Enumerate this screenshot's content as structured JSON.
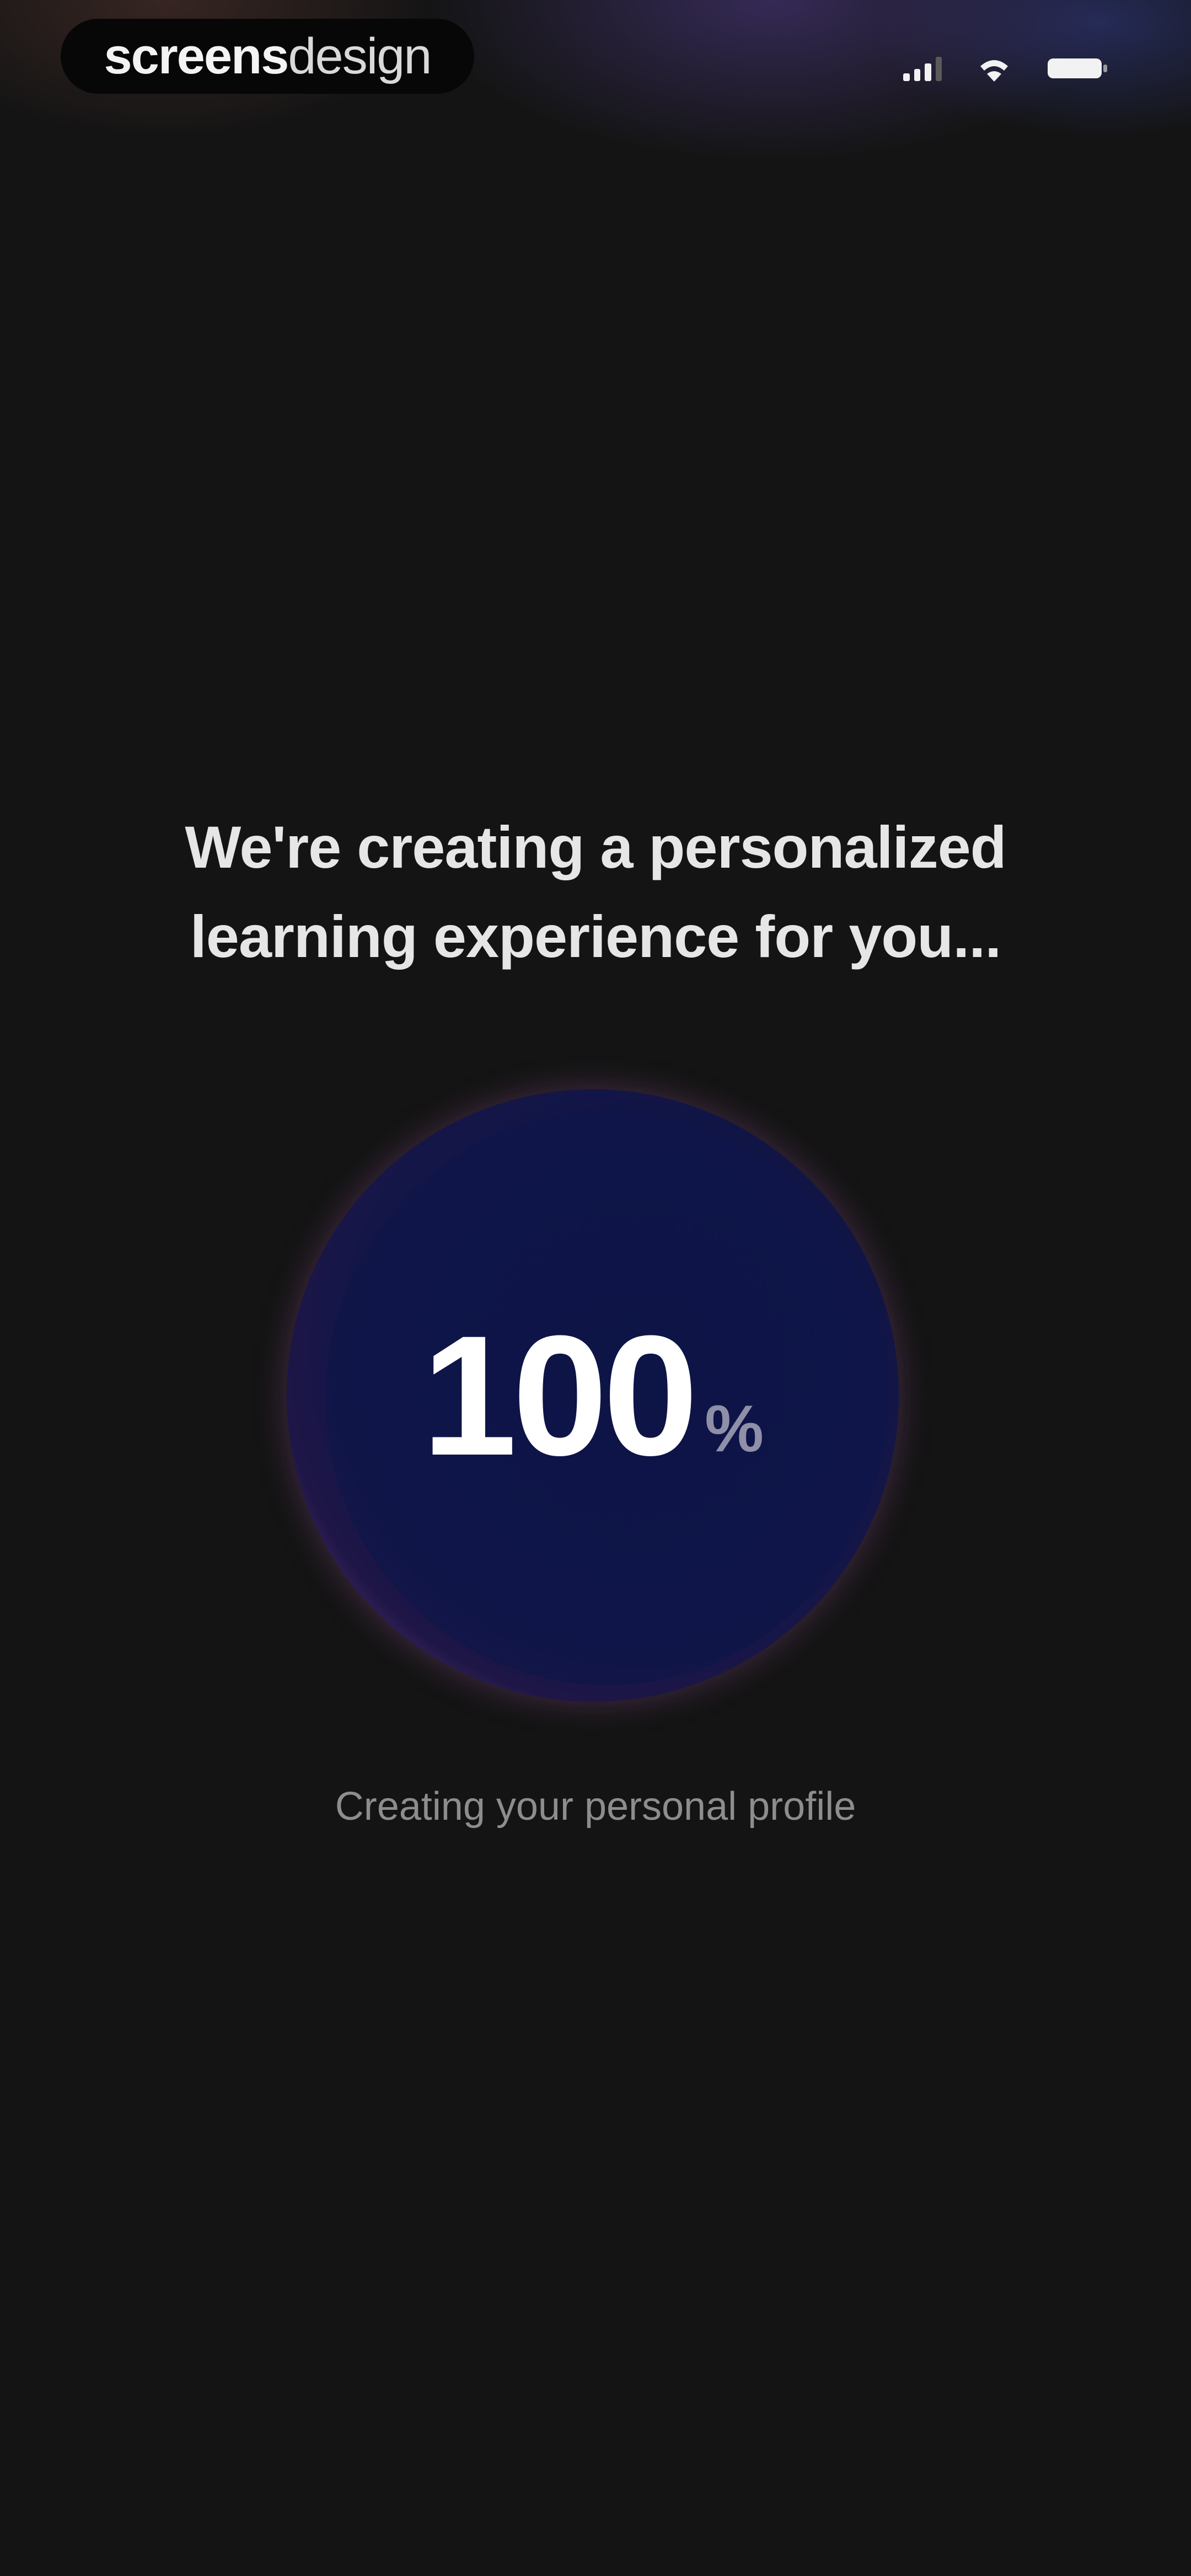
{
  "watermark": {
    "part1": "screens",
    "part2": "design"
  },
  "status_bar": {
    "icons": [
      "signal-icon",
      "wifi-icon",
      "battery-icon"
    ]
  },
  "main": {
    "headline": "We're creating a personalized learning experience for you...",
    "progress": {
      "value": "100",
      "unit": "%"
    },
    "status_text": "Creating your personal profile"
  },
  "colors": {
    "background": "#141414",
    "orb_core": "#0e1547",
    "orb_rim": "#c882a0"
  }
}
